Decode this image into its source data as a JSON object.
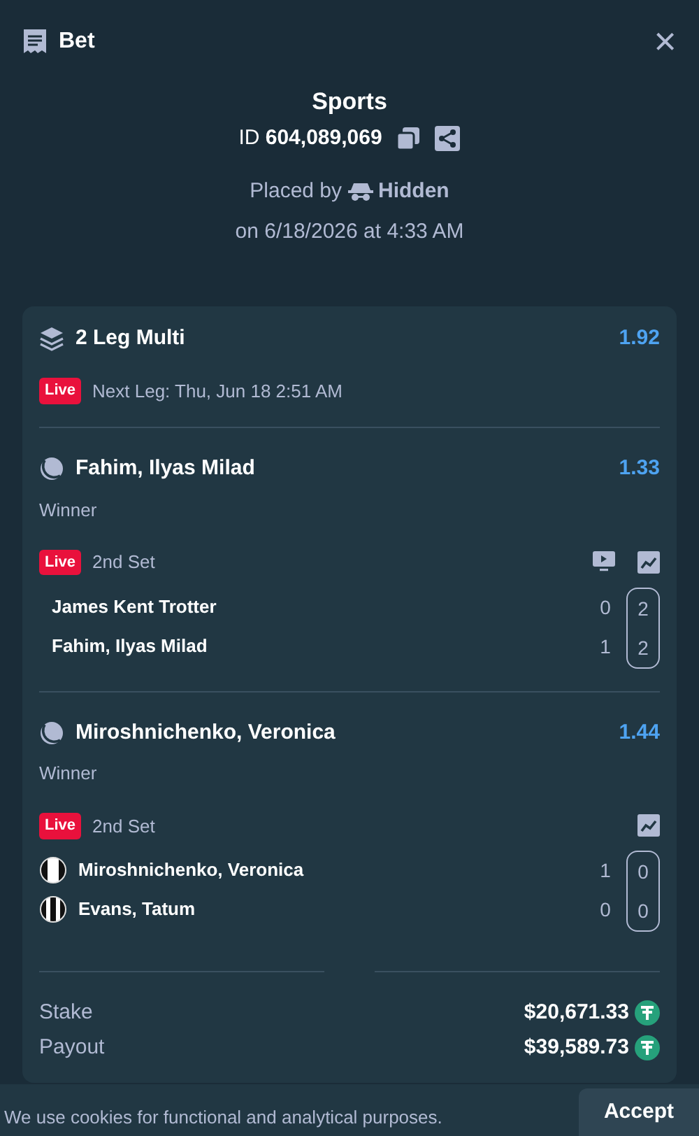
{
  "header": {
    "title": "Bet",
    "close": "×"
  },
  "bet": {
    "category": "Sports",
    "id_label": "ID",
    "id": "604,089,069",
    "placed_by": "Placed by",
    "user": "Hidden",
    "placed_on": "on 6/18/2026 at 4:33 AM"
  },
  "multi": {
    "title": "2 Leg Multi",
    "odds": "1.92",
    "badge": "Live",
    "next_leg": "Next Leg: Thu, Jun 18 2:51 AM"
  },
  "legs": [
    {
      "name": "Fahim, Ilyas Milad",
      "odds": "1.33",
      "market": "Winner",
      "badge": "Live",
      "period": "2nd Set",
      "stream": true,
      "stats": true,
      "players": [
        {
          "name": "James Kent Trotter",
          "kind": "plain",
          "sets": "0",
          "games": "2"
        },
        {
          "name": "Fahim, Ilyas Milad",
          "kind": "plain",
          "sets": "1",
          "games": "2"
        }
      ]
    },
    {
      "name": "Miroshnichenko, Veronica",
      "odds": "1.44",
      "market": "Winner",
      "badge": "Live",
      "period": "2nd Set",
      "stream": false,
      "stats": true,
      "players": [
        {
          "name": "Miroshnichenko, Veronica",
          "kind": "wide",
          "sets": "1",
          "games": "0"
        },
        {
          "name": "Evans, Tatum",
          "kind": "narrow",
          "sets": "0",
          "games": "0"
        }
      ]
    }
  ],
  "totals": [
    {
      "label": "Stake",
      "amount": "$20,671.33"
    },
    {
      "label": "Payout",
      "amount": "$39,589.73"
    }
  ],
  "cookie": {
    "text": "We use cookies for functional and analytical purposes.",
    "button": "Accept"
  }
}
